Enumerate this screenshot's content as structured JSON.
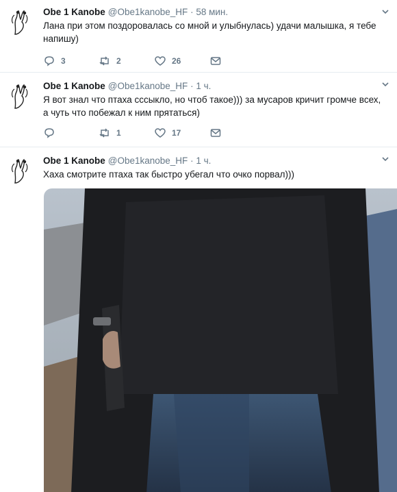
{
  "tweets": [
    {
      "name": "Obe 1 Kanobe",
      "handle": "@Obe1kanobe_HF",
      "time": "58 мин.",
      "text": "Лана при этом поздоровалась со мной и улыбнулась) удачи малышка, я тебе напишу)",
      "replies": "3",
      "retweets": "2",
      "likes": "26"
    },
    {
      "name": "Obe 1 Kanobe",
      "handle": "@Obe1kanobe_HF",
      "time": "1 ч.",
      "text": "Я вот знал что птаха сссыкло, но чтоб такое)))  за мусаров кричит громче всех, а чуть что побежал к ним прятаться)",
      "replies": "",
      "retweets": "1",
      "likes": "17"
    },
    {
      "name": "Obe 1 Kanobe",
      "handle": "@Obe1kanobe_HF",
      "time": "1 ч.",
      "text": "Хаха смотрите птаха так быстро убегал что очко порвал)))"
    }
  ],
  "separator": "·",
  "icons": {
    "reply": "reply-icon",
    "retweet": "retweet-icon",
    "like": "heart-icon",
    "dm": "envelope-icon",
    "menu": "chevron-down-icon",
    "avatar": "avatar-image"
  },
  "colors": {
    "text": "#14171a",
    "secondary": "#657786",
    "divider": "#e6ecf0"
  }
}
